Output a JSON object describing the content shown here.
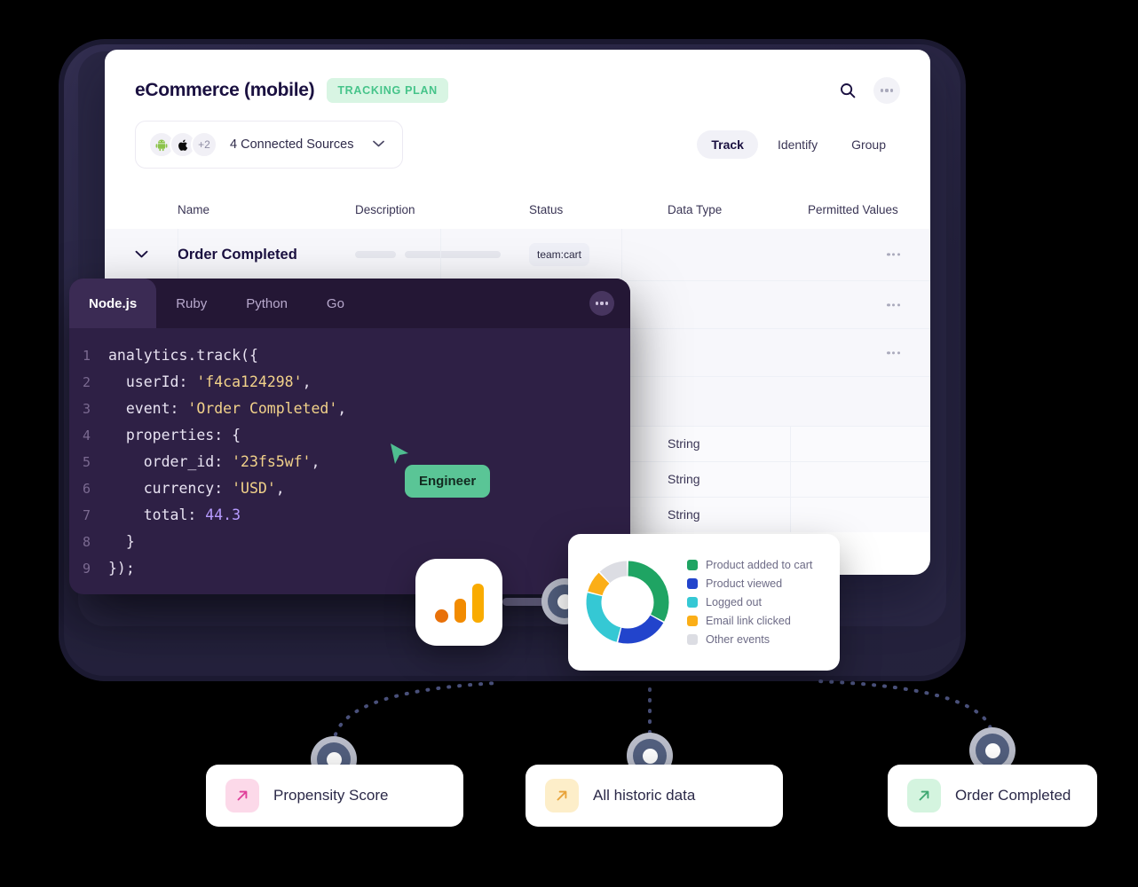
{
  "app": {
    "title": "eCommerce (mobile)",
    "plan_badge": "TRACKING PLAN",
    "search_icon": "search-icon",
    "more_icon": "more-horizontal-icon"
  },
  "sources": {
    "label": "4 Connected Sources",
    "overflow": "+2",
    "avatars": [
      "android-icon",
      "apple-icon",
      "+2"
    ],
    "chevron": "chevron-down-icon"
  },
  "segments": [
    {
      "label": "Track",
      "active": true
    },
    {
      "label": "Identify",
      "active": false
    },
    {
      "label": "Group",
      "active": false
    }
  ],
  "table": {
    "columns": [
      "Name",
      "Description",
      "Status",
      "Data Type",
      "Permitted Values"
    ],
    "rows": [
      {
        "name": "Order Completed",
        "status": "team:cart",
        "data_type": "",
        "expand_icon": "chevron-down-icon",
        "menu_icon": "more-horizontal-icon"
      },
      {
        "name": "",
        "status": "",
        "data_type": "",
        "menu_icon": "more-horizontal-icon"
      },
      {
        "name": "",
        "status": "",
        "data_type": "",
        "menu_icon": "more-horizontal-icon"
      },
      {
        "name": "",
        "status": "",
        "data_type": ""
      },
      {
        "name": "",
        "status": "",
        "data_type": "String"
      },
      {
        "name": "",
        "status": "",
        "data_type": "String"
      },
      {
        "name": "",
        "status": "",
        "data_type": "String"
      }
    ]
  },
  "code": {
    "tabs": [
      {
        "label": "Node.js",
        "active": true
      },
      {
        "label": "Ruby",
        "active": false
      },
      {
        "label": "Python",
        "active": false
      },
      {
        "label": "Go",
        "active": false
      }
    ],
    "more_icon": "more-horizontal-icon",
    "lines": [
      {
        "n": "1",
        "text": "analytics.track({"
      },
      {
        "n": "2",
        "text": "  userId: 'f4ca124298',"
      },
      {
        "n": "3",
        "text": "  event: 'Order Completed',"
      },
      {
        "n": "4",
        "text": "  properties: {"
      },
      {
        "n": "5",
        "text": "    order_id: '23fs5wf',"
      },
      {
        "n": "6",
        "text": "    currency: 'USD',"
      },
      {
        "n": "7",
        "text": "    total: 44.3"
      },
      {
        "n": "8",
        "text": "  }"
      },
      {
        "n": "9",
        "text": "});"
      }
    ]
  },
  "cursor": {
    "label": "Engineer",
    "color": "#5ac596"
  },
  "analytics_icon": {
    "name": "google-analytics-icon"
  },
  "chart_data": {
    "type": "pie",
    "title": "",
    "legend_position": "right",
    "categories": [
      "Product added to cart",
      "Product viewed",
      "Logged out",
      "Email link clicked",
      "Other events"
    ],
    "values": [
      33,
      21,
      25,
      9,
      12
    ],
    "colors": [
      "#1fa463",
      "#2244cc",
      "#35c8d4",
      "#fbae17",
      "#dcdde3"
    ]
  },
  "bottom_cards": [
    {
      "label": "Propensity Score",
      "tile_color": "#fcd9e9",
      "arrow_color": "#e0409a",
      "icon": "arrow-up-right-icon"
    },
    {
      "label": "All historic data",
      "tile_color": "#fdeec9",
      "arrow_color": "#e8a33a",
      "icon": "arrow-up-right-icon"
    },
    {
      "label": "Order Completed",
      "tile_color": "#d4f4df",
      "arrow_color": "#3fa872",
      "icon": "arrow-up-right-icon"
    }
  ]
}
